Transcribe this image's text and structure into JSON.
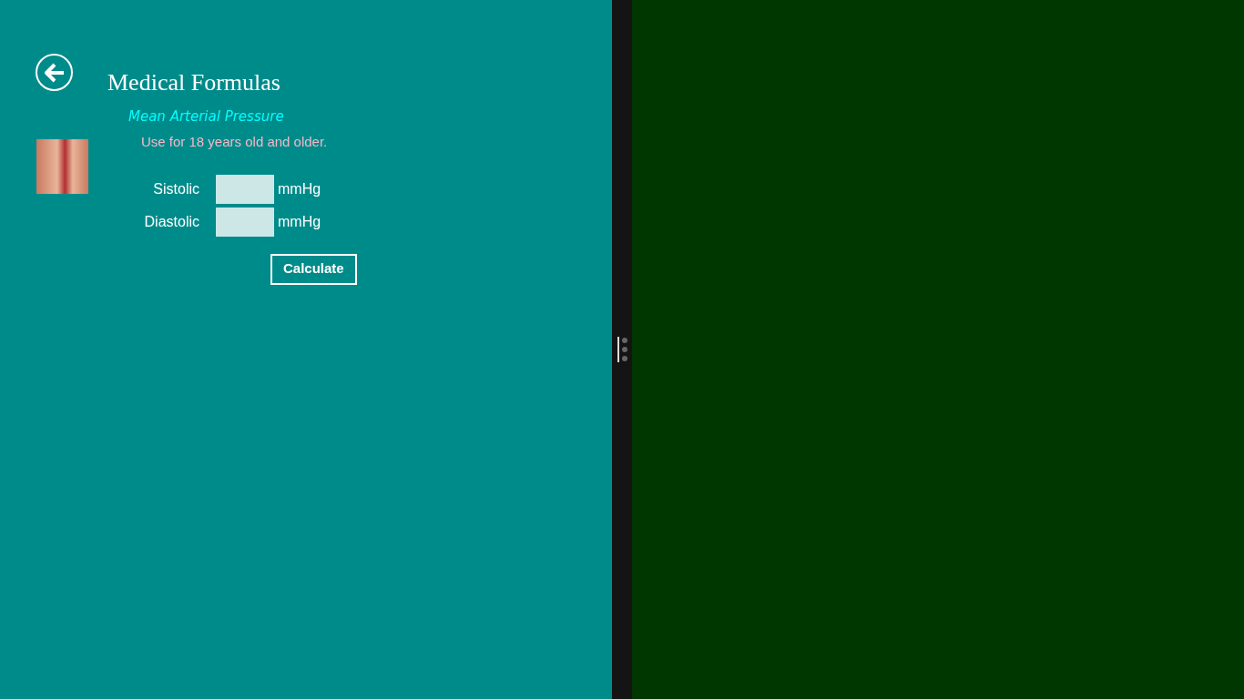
{
  "title": "Medical Formulas",
  "formula": {
    "name": "Mean Arterial Pressure",
    "note": "Use for 18 years old and older."
  },
  "fields": [
    {
      "label": "Sistolic",
      "unit": "mmHg"
    },
    {
      "label": "Diastolic",
      "unit": "mmHg"
    }
  ],
  "button": "Calculate"
}
